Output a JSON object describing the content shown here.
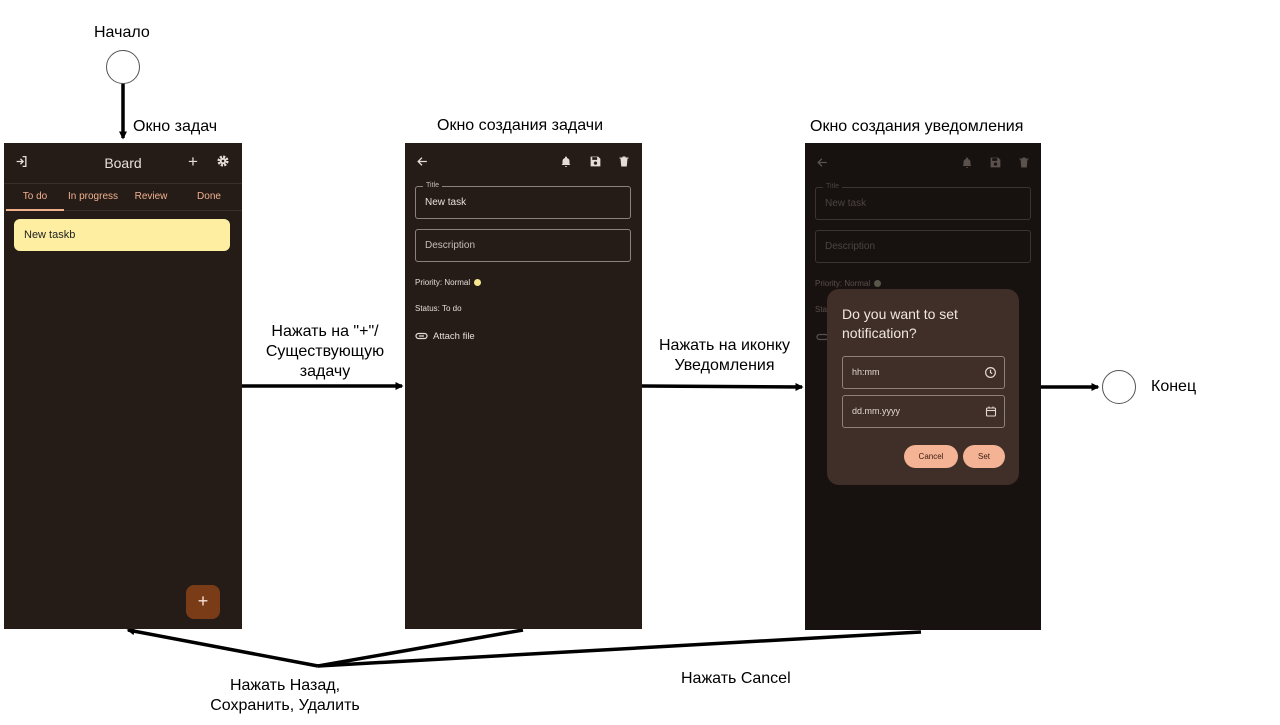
{
  "diagram": {
    "start_label": "Начало",
    "end_label": "Конец",
    "screen_titles": {
      "board": "Окно задач",
      "task": "Окно создания задачи",
      "notification": "Окно создания уведомления"
    },
    "edges": {
      "board_to_task_line1": "Нажать на \"+\"/",
      "board_to_task_line2": "Существующую",
      "board_to_task_line3": "задачу",
      "task_to_notification_line1": "Нажать на иконку",
      "task_to_notification_line2": "Уведомления",
      "back_line1": "Нажать Назад,",
      "back_line2": "Сохранить, Удалить",
      "cancel": "Нажать Cancel"
    }
  },
  "board_screen": {
    "title": "Board",
    "tabs": [
      "To do",
      "In progress",
      "Review",
      "Done"
    ],
    "task_card": "New taskb",
    "fab_label": "+",
    "add_label": "+",
    "icons": [
      "logout-icon",
      "plus-icon",
      "gear-icon"
    ]
  },
  "task_screen": {
    "title_legend": "Title",
    "title_value": "New task",
    "description_placeholder": "Description",
    "priority_text": "Priority: Normal",
    "status_text": "Status: To do",
    "attach_text": "Attach file",
    "icons": [
      "back-arrow-icon",
      "bell-icon",
      "save-icon",
      "trash-icon",
      "paperclip-icon"
    ]
  },
  "notification_screen": {
    "title_legend": "Title",
    "title_value": "New task",
    "description_placeholder": "Description",
    "priority_text": "Priority: Normal",
    "status_text_partial": "Stat",
    "dialog": {
      "title": "Do you want to set notification?",
      "time_placeholder": "hh:mm",
      "date_placeholder": "dd.mm.yyyy",
      "cancel_label": "Cancel",
      "set_label": "Set"
    },
    "icons": [
      "back-arrow-icon",
      "bell-icon",
      "save-icon",
      "trash-icon",
      "clock-icon",
      "calendar-icon"
    ]
  },
  "colors": {
    "phone_bg": "#251c18",
    "dim_bg": "#171110",
    "accent": "#f0b08e",
    "task_card": "#fdeea2",
    "fab": "#7a3c16",
    "dialog_bg": "#3f2f28",
    "button": "#f5b395"
  }
}
